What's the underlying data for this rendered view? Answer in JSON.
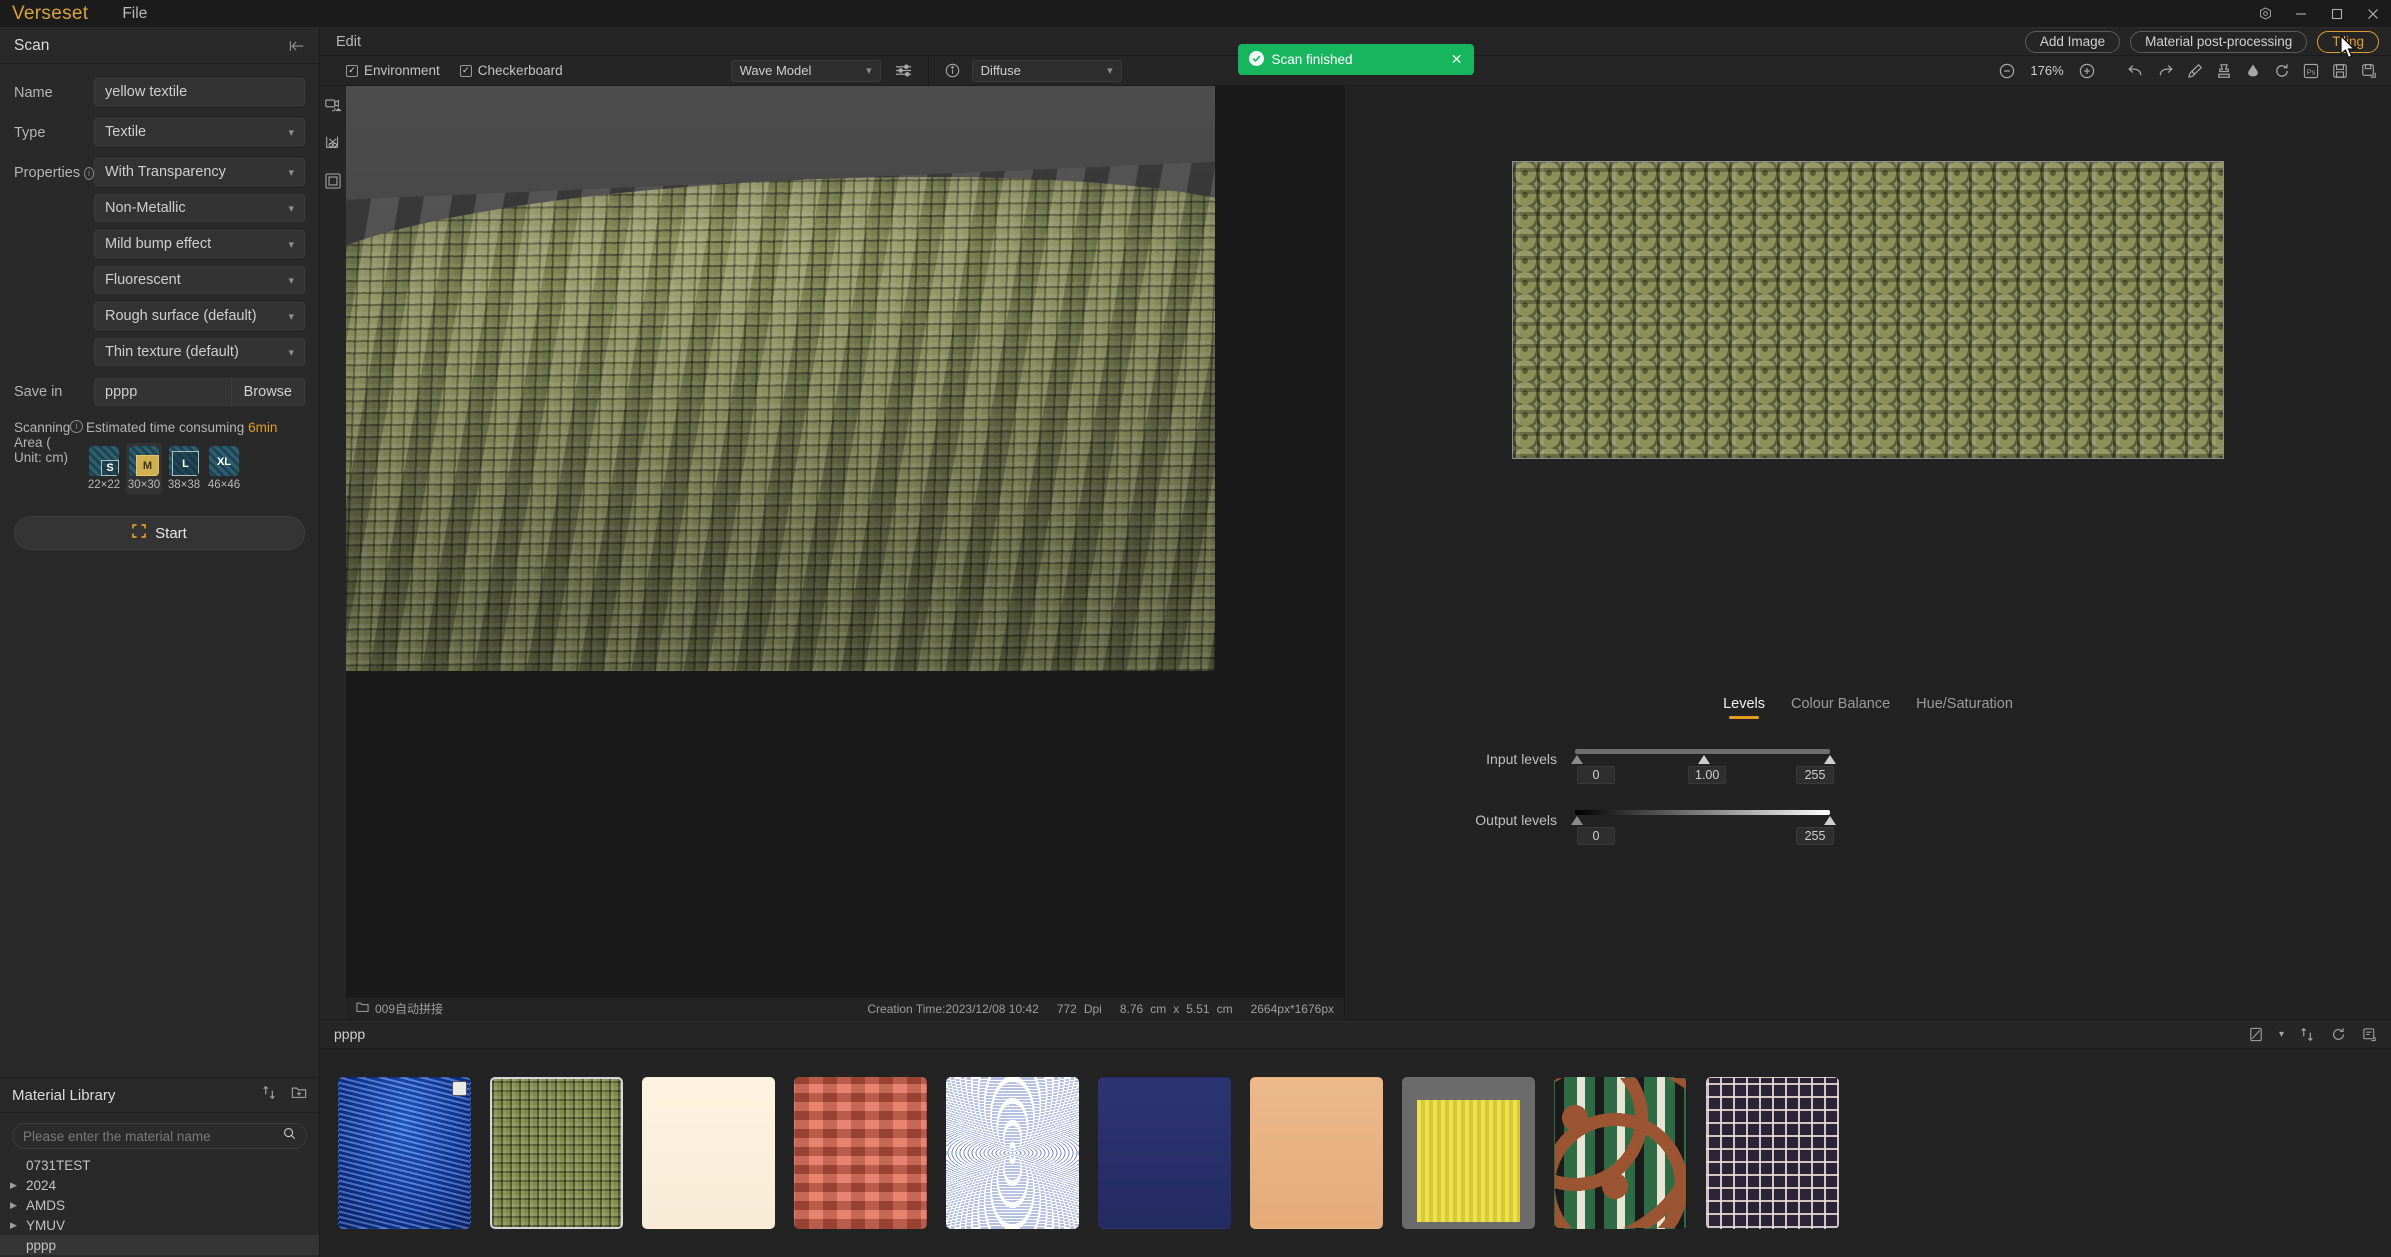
{
  "app": {
    "brand": "Verseset",
    "menus": [
      "File"
    ]
  },
  "window_controls": {
    "settings": "settings-icon",
    "minimize": "—",
    "maximize": "☐",
    "close": "✕"
  },
  "scan_panel": {
    "title": "Scan",
    "collapse_icon": "collapse-left-icon",
    "fields": {
      "name_label": "Name",
      "name_value": "yellow textile",
      "type_label": "Type",
      "type_value": "Textile",
      "properties_label": "Properties",
      "properties_values": [
        "With Transparency",
        "Non-Metallic",
        "Mild bump effect",
        "Fluorescent",
        "Rough surface (default)",
        "Thin texture (default)"
      ],
      "save_in_label": "Save in",
      "save_in_value": "pppp",
      "browse_label": "Browse"
    },
    "scanning_area": {
      "label": "Scanning Area ( Unit: cm)",
      "estimate_prefix": "Estimated time consuming",
      "estimate_value": "6min",
      "sizes": [
        {
          "code": "S",
          "dims": "22×22",
          "selected": false
        },
        {
          "code": "M",
          "dims": "30×30",
          "selected": true
        },
        {
          "code": "L",
          "dims": "38×38",
          "selected": false
        },
        {
          "code": "XL",
          "dims": "46×46",
          "selected": false
        }
      ]
    },
    "start_label": "Start"
  },
  "material_library": {
    "title": "Material Library",
    "sort_icon": "sort-icon",
    "new_folder_icon": "new-folder-icon",
    "search_placeholder": "Please enter the material name",
    "search_value": "",
    "search_icon": "search-icon",
    "tree": [
      {
        "label": "0731TEST",
        "expandable": false,
        "selected": false
      },
      {
        "label": "2024",
        "expandable": true,
        "selected": false
      },
      {
        "label": "AMDS",
        "expandable": true,
        "selected": false
      },
      {
        "label": "YMUV",
        "expandable": true,
        "selected": false
      },
      {
        "label": "pppp",
        "expandable": false,
        "selected": true
      }
    ]
  },
  "edit_bar": {
    "menu": "Edit",
    "buttons": [
      {
        "label": "Add Image",
        "active": false
      },
      {
        "label": "Material post-processing",
        "active": false
      },
      {
        "label": "Tiling",
        "active": true
      }
    ]
  },
  "toast": {
    "message": "Scan finished",
    "close": "✕",
    "color": "#17b65e",
    "check_icon": "check-circle-icon"
  },
  "viewport_toolbar": {
    "camera_icon": "camera-icon",
    "crop_icon": "crop-scissors-icon",
    "frame_icon": "frame-icon",
    "environment_label": "Environment",
    "environment_checked": true,
    "checkerboard_label": "Checkerboard",
    "checkerboard_checked": true,
    "model_value": "Wave Model",
    "settings_icon": "sliders-icon"
  },
  "map_toolbar": {
    "info_icon": "info-icon",
    "channel_value": "Diffuse",
    "zoom_out_icon": "minus-circle-icon",
    "zoom_value": "176%",
    "zoom_in_icon": "plus-circle-icon",
    "tools": [
      "undo-icon",
      "redo-icon",
      "brush-icon",
      "stamp-icon",
      "eyedropper-icon",
      "reset-icon",
      "photoshop-icon",
      "save-icon",
      "save-as-icon"
    ]
  },
  "viewport_status": {
    "folder_icon": "folder-icon",
    "project": "009自动拼接",
    "creation_time": "Creation Time:2023/12/08 10:42",
    "dpi_value": "772",
    "dpi_label": "Dpi",
    "width_cm": "8.76",
    "unit_1": "cm",
    "times": "x",
    "height_cm": "5.51",
    "unit_2": "cm",
    "pixels": "2664px*1676px"
  },
  "adjust_panel": {
    "tabs": [
      {
        "label": "Levels",
        "active": true
      },
      {
        "label": "Colour Balance",
        "active": false
      },
      {
        "label": "Hue/Saturation",
        "active": false
      }
    ],
    "input_levels": {
      "label": "Input levels",
      "black": "0",
      "gamma": "1.00",
      "white": "255"
    },
    "output_levels": {
      "label": "Output levels",
      "black": "0",
      "white": "255"
    }
  },
  "bottom_strip": {
    "title": "pppp",
    "icons": [
      "image-mode-icon",
      "chevron-down-icon",
      "sort-icon",
      "refresh-icon",
      "export-icon"
    ],
    "thumbnails": [
      {
        "name": "blue-velvet",
        "selected": false,
        "badge": true
      },
      {
        "name": "olive-waffle-knit",
        "selected": true,
        "badge": false
      },
      {
        "name": "cream-plain",
        "selected": false,
        "badge": false
      },
      {
        "name": "red-quilted",
        "selected": false,
        "badge": false
      },
      {
        "name": "blue-white-moire",
        "selected": false,
        "badge": false
      },
      {
        "name": "navy-solid",
        "selected": false,
        "badge": false
      },
      {
        "name": "tan-leather",
        "selected": false,
        "badge": false
      },
      {
        "name": "yellow-mesh",
        "selected": false,
        "badge": false
      },
      {
        "name": "green-brown-pattern",
        "selected": false,
        "badge": false
      },
      {
        "name": "monogram-print",
        "selected": false,
        "badge": false
      }
    ]
  },
  "colors": {
    "accent": "#e09c28",
    "success": "#17b65e",
    "panel_bg": "#292929",
    "app_bg": "#222222",
    "material_olive": "#8b9059"
  }
}
